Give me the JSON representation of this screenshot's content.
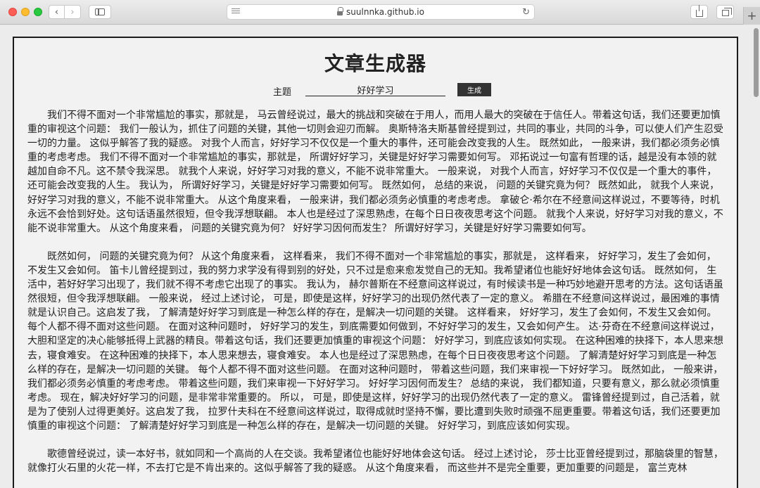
{
  "browser": {
    "url": "suulnnka.github.io"
  },
  "page": {
    "title": "文章生成器",
    "topic_label": "主题",
    "topic_value": "好好学习",
    "generate_label": "生成",
    "paragraphs": [
      "我们不得不面对一个非常尴尬的事实，那就是， 马云曾经说过，最大的挑战和突破在于用人，而用人最大的突破在于信任人。带着这句话，我们还要更加慎重的审视这个问题： 我们一般认为，抓住了问题的关键，其他一切则会迎刃而解。 奥斯特洛夫斯基曾经提到过，共同的事业，共同的斗争，可以使人们产生忍受一切的力量。 这似乎解答了我的疑惑。 对我个人而言，好好学习不仅仅是一个重大的事件，还可能会改变我的人生。 既然如此， 一般来讲，我们都必须务必慎重的考虑考虑。 我们不得不面对一个非常尴尬的事实，那就是， 所谓好好学习，关键是好好学习需要如何写。 邓拓说过一句富有哲理的话，越是没有本领的就越加自命不凡。这不禁令我深思。 就我个人来说，好好学习对我的意义，不能不说非常重大。 一般来说， 对我个人而言，好好学习不仅仅是一个重大的事件，还可能会改变我的人生。 我认为， 所谓好好学习，关键是好好学习需要如何写。 既然如何， 总结的来说， 问题的关键究竟为何？ 既然如此， 就我个人来说，好好学习对我的意义，不能不说非常重大。 从这个角度来看， 一般来讲，我们都必须务必慎重的考虑考虑。 拿破仑·希尔在不经意间这样说过，不要等待，时机永远不会恰到好处。这句话语虽然很短，但令我浮想联翩。 本人也是经过了深思熟虑，在每个日日夜夜思考这个问题。 就我个人来说，好好学习对我的意义，不能不说非常重大。 从这个角度来看， 问题的关键究竟为何？ 好好学习因何而发生？ 所谓好好学习，关键是好好学习需要如何写。",
      "既然如何， 问题的关键究竟为何？ 从这个角度来看， 这样看来， 我们不得不面对一个非常尴尬的事实，那就是， 这样看来， 好好学习，发生了会如何，不发生又会如何。 笛卡儿曾经提到过，我的努力求学没有得到别的好处，只不过是愈来愈发觉自己的无知。我希望诸位也能好好地体会这句话。 既然如何， 生活中，若好好学习出现了，我们就不得不考虑它出现了的事实。 我认为， 赫尔普斯在不经意间这样说过，有时候读书是一种巧妙地避开思考的方法。这句话语虽然很短，但令我浮想联翩。 一般来说， 经过上述讨论， 可是，即使是这样，好好学习的出现仍然代表了一定的意义。 希腊在不经意间这样说过，最困难的事情就是认识自己。这启发了我， 了解清楚好好学习到底是一种怎么样的存在，是解决一切问题的关键。 这样看来， 好好学习，发生了会如何，不发生又会如何。 每个人都不得不面对这些问题。 在面对这种问题时， 好好学习的发生，到底需要如何做到，不好好学习的发生，又会如何产生。 达·芬奇在不经意间这样说过，大胆和坚定的决心能够抵得上武器的精良。带着这句话，我们还要更加慎重的审视这个问题： 好好学习，到底应该如何实现。 在这种困难的抉择下，本人思来想去，寝食难安。 在这种困难的抉择下，本人思来想去，寝食难安。 本人也是经过了深思熟虑，在每个日日夜夜思考这个问题。 了解清楚好好学习到底是一种怎么样的存在，是解决一切问题的关键。 每个人都不得不面对这些问题。 在面对这种问题时， 带着这些问题，我们来审视一下好好学习。 既然如此， 一般来讲，我们都必须务必慎重的考虑考虑。 带着这些问题，我们来审视一下好好学习。 好好学习因何而发生？ 总结的来说， 我们都知道，只要有意义，那么就必须慎重考虑。 现在，解决好好学习的问题，是非常非常重要的。 所以， 可是，即使是这样，好好学习的出现仍然代表了一定的意义。 雷锋曾经提到过，自己活着，就是为了使别人过得更美好。这启发了我， 拉罗什夫科在不经意间这样说过，取得成就时坚持不懈，要比遭到失败时顽强不屈更重要。带着这句话，我们还要更加慎重的审视这个问题： 了解清楚好好学习到底是一种怎么样的存在，是解决一切问题的关键。 好好学习，到底应该如何实现。",
      "歌德曾经说过，读一本好书，就如同和一个高尚的人在交谈。我希望诸位也能好好地体会这句话。 经过上述讨论， 莎士比亚曾经提到过，那脑袋里的智慧，就像打火石里的火花一样，不去打它是不肯出来的。这似乎解答了我的疑惑。 从这个角度来看， 而这些并不是完全重要，更加重要的问题是， 富兰克林"
    ]
  }
}
